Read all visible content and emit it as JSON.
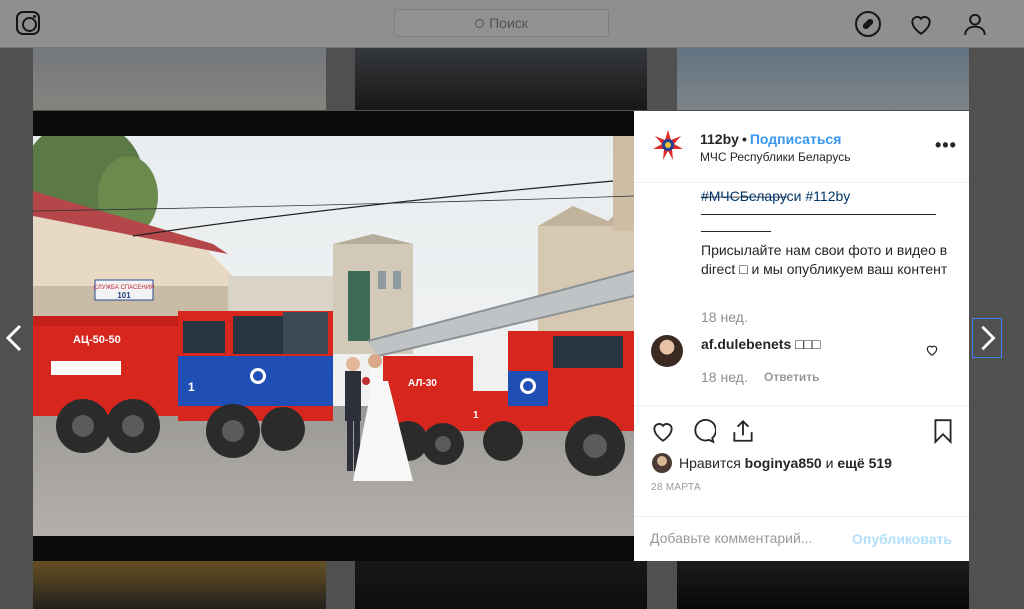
{
  "header": {
    "search_placeholder": "Поиск"
  },
  "post": {
    "account": "112by",
    "separator": "•",
    "follow_label": "Подписаться",
    "location": "МЧС Республики Беларусь",
    "more_label": "•••",
    "top_underscores": "____________",
    "hashtags": "#МЧСБеларуси #112by",
    "caption": "Присылайте нам свои фото и видео в direct □ и мы опубликуем ваш контент",
    "caption_time": "18 нед.",
    "comment": {
      "user": "af.dulebenets",
      "text": "□□□",
      "time": "18 нед.",
      "reply_label": "Ответить"
    },
    "likes_prefix": "Нравится",
    "likes_user": "boginya850",
    "likes_and": "и",
    "likes_more": "ещё 519",
    "date": "28 МАРТА",
    "add_comment_placeholder": "Добавьте комментарий...",
    "publish_label": "Опубликовать"
  },
  "photo": {
    "sign_text": "СЛУЖБА СПАСЕНИЯ",
    "sign_number": "101",
    "truck1_label": "АЦ-50-50",
    "truck2_label": "АЛ-30",
    "unit_number_1": "1",
    "unit_number_2": "1"
  },
  "colors": {
    "accent": "#3897f0",
    "truck_red": "#d7261e",
    "truck_blue": "#1f4fb5"
  }
}
